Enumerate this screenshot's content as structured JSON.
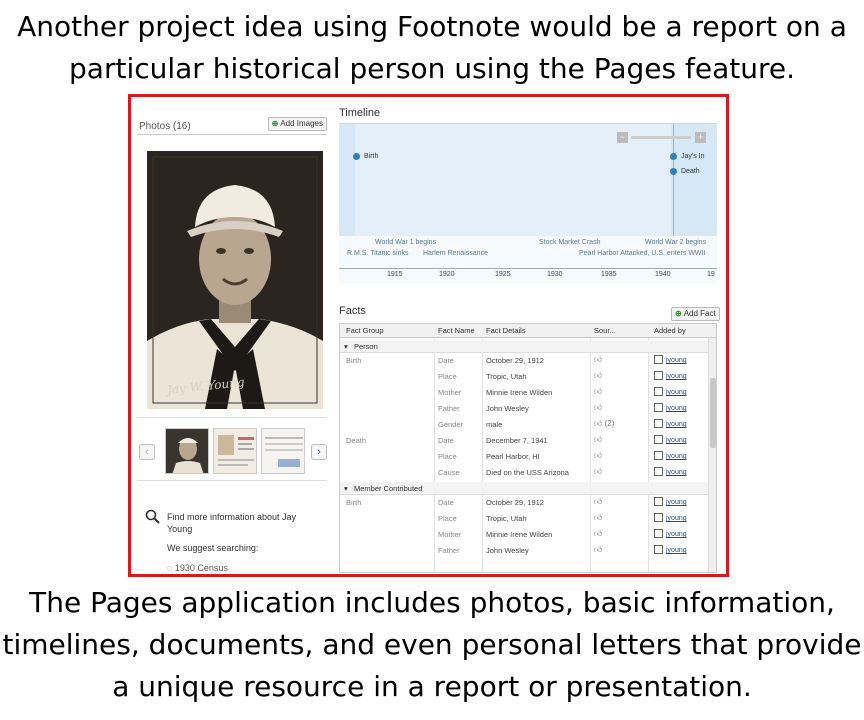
{
  "caption_top": "Another project idea using Footnote would be a report on a particular historical person using the Pages feature.",
  "caption_bottom": "The Pages application includes photos, basic information, timelines, documents, and even personal letters that provide a unique resource in a report or presentation.",
  "colors": {
    "frame_border": "#d8191f",
    "timeline_bg": "#d6e7f5",
    "link": "#1a4fa0"
  },
  "photos": {
    "title": "Photos (16)",
    "add_images": "Add Images",
    "signature": "Jay W. Young",
    "prev_icon": "‹",
    "next_icon": "›"
  },
  "find": {
    "text": "Find more information about Jay Young",
    "suggest": "We suggest searching:",
    "census": "1930 Census"
  },
  "timeline": {
    "title": "Timeline",
    "markers": [
      {
        "label": "Birth"
      },
      {
        "label": "Jay's In"
      },
      {
        "label": "Death"
      }
    ],
    "events": [
      "World War 1 begins",
      "R.M.S. Titanic sinks",
      "Harlem Renaissance",
      "Stock Market Crash",
      "World War 2 begins",
      "Pearl Harbor Attacked, U.S. enters WWII"
    ],
    "ticks": [
      "1915",
      "1920",
      "1925",
      "1930",
      "1935",
      "1940",
      "19"
    ]
  },
  "facts": {
    "title": "Facts",
    "add_fact": "Add Fact",
    "headers": [
      "Fact Group",
      "Fact Name",
      "Fact Details",
      "Sour...",
      "Added by"
    ],
    "groups": [
      {
        "label": "Person"
      },
      {
        "label": "Member Contributed"
      }
    ],
    "rows": [
      {
        "group": "Birth",
        "name": "Date",
        "details": "October 29, 1912",
        "src": "",
        "added": "jyoung"
      },
      {
        "group": "",
        "name": "Place",
        "details": "Tropic, Utah",
        "src": "",
        "added": "jyoung"
      },
      {
        "group": "",
        "name": "Mother",
        "details": "Minnie Irene Wilden",
        "src": "",
        "added": "jyoung"
      },
      {
        "group": "",
        "name": "Father",
        "details": "John Wesley",
        "src": "",
        "added": "jyoung"
      },
      {
        "group": "",
        "name": "Gender",
        "details": "male",
        "src": "(2)",
        "added": "jyoung"
      },
      {
        "group": "Death",
        "name": "Date",
        "details": "December 7, 1941",
        "src": "",
        "added": "jyoung"
      },
      {
        "group": "",
        "name": "Place",
        "details": "Pearl Harbor, HI",
        "src": "",
        "added": "jyoung"
      },
      {
        "group": "",
        "name": "Cause",
        "details": "Died on the USS Arizona",
        "src": "",
        "added": "jyoung"
      },
      {
        "group": "Birth",
        "name": "Date",
        "details": "October 29, 1912",
        "src": "",
        "added": "jyoung"
      },
      {
        "group": "",
        "name": "Place",
        "details": "Tropic, Utah",
        "src": "",
        "added": "jyoung"
      },
      {
        "group": "",
        "name": "Mother",
        "details": "Minnie Irene Wilden",
        "src": "",
        "added": "jyoung"
      },
      {
        "group": "",
        "name": "Father",
        "details": "John Wesley",
        "src": "",
        "added": "jyoung"
      }
    ]
  }
}
